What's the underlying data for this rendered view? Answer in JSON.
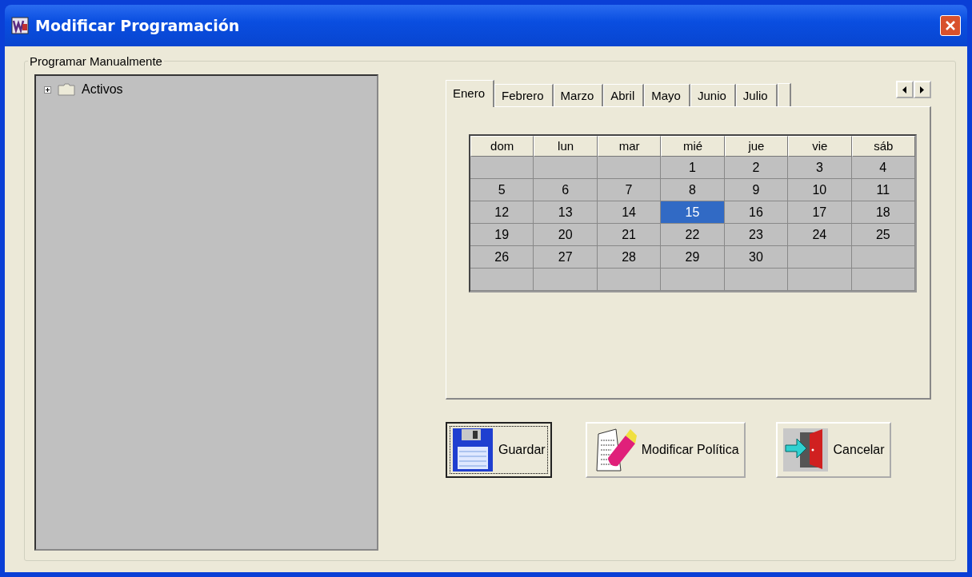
{
  "window": {
    "title": "Modificar Programación"
  },
  "group": {
    "label": "Programar Manualmente"
  },
  "tree": [
    {
      "label": "Activos",
      "expanded": false
    }
  ],
  "tabs": [
    {
      "label": "Enero",
      "selected": true
    },
    {
      "label": "Febrero",
      "selected": false
    },
    {
      "label": "Marzo",
      "selected": false
    },
    {
      "label": "Abril",
      "selected": false
    },
    {
      "label": "Mayo",
      "selected": false
    },
    {
      "label": "Junio",
      "selected": false
    },
    {
      "label": "Julio",
      "selected": false
    }
  ],
  "calendar": {
    "columns": [
      "dom",
      "lun",
      "mar",
      "mié",
      "jue",
      "vie",
      "sáb"
    ],
    "weeks": [
      [
        {
          "selected": false
        },
        {
          "selected": false
        },
        {
          "selected": false
        },
        {
          "day": "1",
          "selected": false
        },
        {
          "day": "2",
          "selected": false
        },
        {
          "day": "3",
          "selected": false
        },
        {
          "day": "4",
          "selected": false
        }
      ],
      [
        {
          "day": "5",
          "selected": false
        },
        {
          "day": "6",
          "selected": false
        },
        {
          "day": "7",
          "selected": false
        },
        {
          "day": "8",
          "selected": false
        },
        {
          "day": "9",
          "selected": false
        },
        {
          "day": "10",
          "selected": false
        },
        {
          "day": "11",
          "selected": false
        }
      ],
      [
        {
          "day": "12",
          "selected": false
        },
        {
          "day": "13",
          "selected": false
        },
        {
          "day": "14",
          "selected": false
        },
        {
          "day": "15",
          "selected": true
        },
        {
          "day": "16",
          "selected": false
        },
        {
          "day": "17",
          "selected": false
        },
        {
          "day": "18",
          "selected": false
        }
      ],
      [
        {
          "day": "19",
          "selected": false
        },
        {
          "day": "20",
          "selected": false
        },
        {
          "day": "21",
          "selected": false
        },
        {
          "day": "22",
          "selected": false
        },
        {
          "day": "23",
          "selected": false
        },
        {
          "day": "24",
          "selected": false
        },
        {
          "day": "25",
          "selected": false
        }
      ],
      [
        {
          "day": "26",
          "selected": false
        },
        {
          "day": "27",
          "selected": false
        },
        {
          "day": "28",
          "selected": false
        },
        {
          "day": "29",
          "selected": false
        },
        {
          "day": "30",
          "selected": false
        },
        {
          "selected": false
        },
        {
          "selected": false
        }
      ],
      [
        {
          "selected": false
        },
        {
          "selected": false
        },
        {
          "selected": false
        },
        {
          "selected": false
        },
        {
          "selected": false
        },
        {
          "selected": false
        },
        {
          "selected": false
        }
      ]
    ]
  },
  "buttons": [
    {
      "kind": "save",
      "label": "Guardar",
      "focused": true
    },
    {
      "kind": "policy",
      "label": "Modificar Política",
      "focused": false
    },
    {
      "kind": "cancel",
      "label": "Cancelar",
      "focused": false
    }
  ]
}
